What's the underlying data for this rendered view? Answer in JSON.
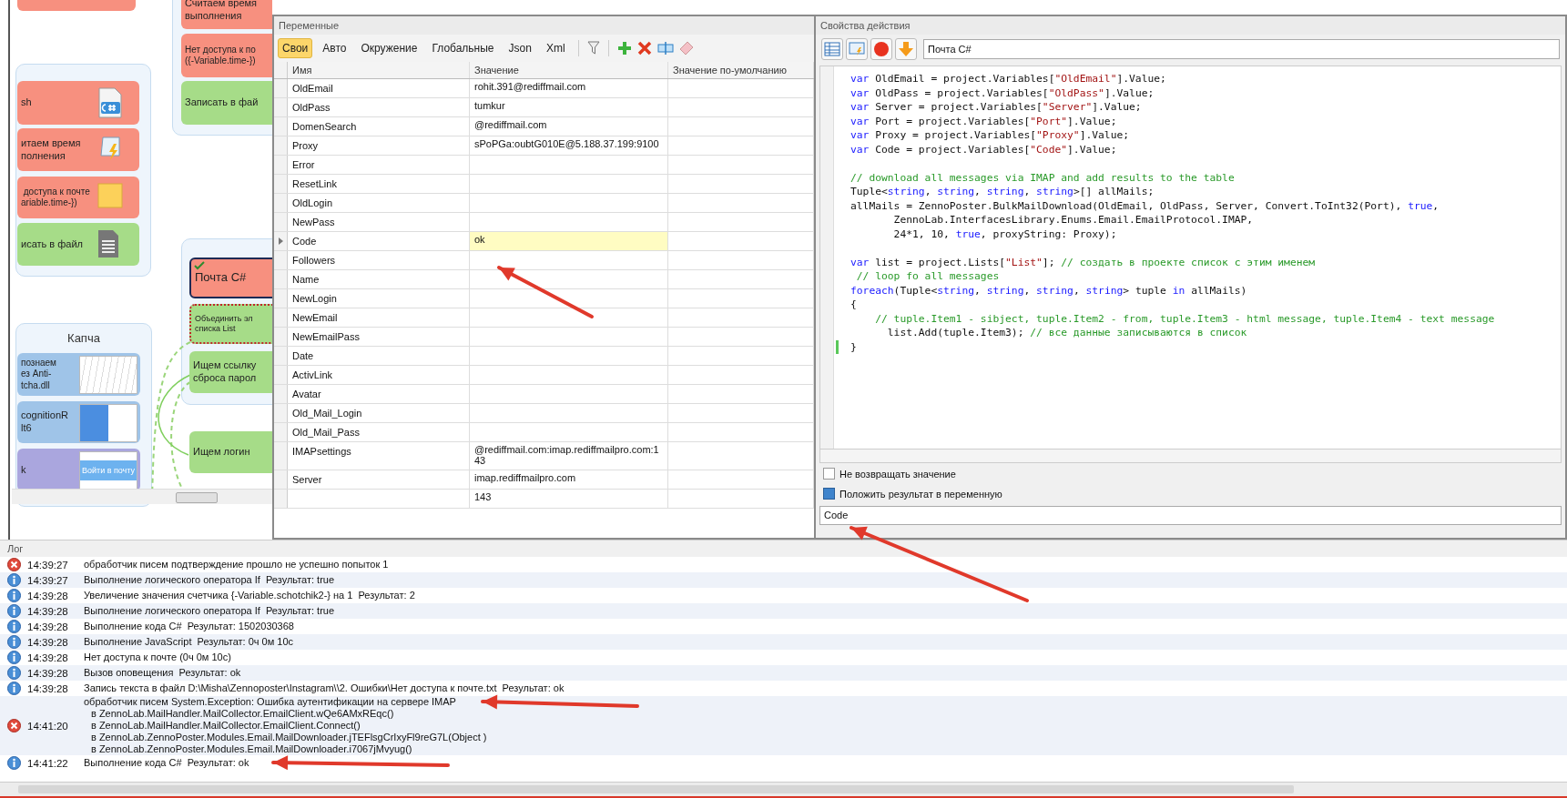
{
  "canvas": {
    "nodes": [
      {
        "lines": [
          "sh"
        ],
        "color": "#f7907f",
        "selected": false,
        "marked": false
      },
      {
        "lines": [
          "итаем время",
          "полнения"
        ],
        "color": "#f7907f",
        "selected": false,
        "marked": false
      },
      {
        "lines": [
          " доступа к почте",
          "ariable.time-})"
        ],
        "color": "#f7907f",
        "selected": false,
        "marked": false
      },
      {
        "lines": [
          "исать в файл"
        ],
        "color": "#a6dc88",
        "selected": false,
        "marked": false
      },
      {
        "lines": [
          "Считаем время",
          "выполнения"
        ],
        "color": "#f7907f",
        "selected": false,
        "marked": false
      },
      {
        "lines": [
          "Нет доступа к по",
          "({-Variable.time-})"
        ],
        "color": "#f7907f",
        "selected": false,
        "marked": false
      },
      {
        "lines": [
          "Записать в фай"
        ],
        "color": "#a6dc88",
        "selected": false,
        "marked": false
      },
      {
        "lines": [
          "Почта C#"
        ],
        "color": "#f7907f",
        "selected": true,
        "marked": false
      },
      {
        "lines": [
          "Объединить эл",
          "списка List"
        ],
        "color": "#a6dc88",
        "selected": false,
        "marked": true
      },
      {
        "lines": [
          "Ищем ссылку",
          "сброса парол"
        ],
        "color": "#a6dc88",
        "selected": false,
        "marked": false
      },
      {
        "lines": [
          "Ищем логин"
        ],
        "color": "#a6dc88",
        "selected": false,
        "marked": false
      },
      {
        "lines": [
          "познаем",
          "ез Anti-",
          "tcha.dll"
        ],
        "color": "#9fc4e8",
        "selected": false,
        "marked": false
      },
      {
        "lines": [
          "cognitionR",
          "lt6"
        ],
        "color": "#9fc4e8",
        "selected": false,
        "marked": false
      },
      {
        "lines": [
          "k"
        ],
        "color": "#aaa6de",
        "selected": false,
        "marked": false,
        "thumbnail": "Войти в почту"
      }
    ],
    "groups": [
      {
        "title": "Капча"
      }
    ]
  },
  "variables": {
    "title": "Переменные",
    "tabs": [
      {
        "label": "Свои",
        "selected": true
      },
      {
        "label": "Авто",
        "selected": false
      },
      {
        "label": "Окружение",
        "selected": false
      },
      {
        "label": "Глобальные",
        "selected": false
      },
      {
        "label": "Json",
        "selected": false
      },
      {
        "label": "Xml",
        "selected": false
      }
    ],
    "columns": [
      "Имя",
      "Значение",
      "Значение по-умолчанию"
    ],
    "rows": [
      {
        "name": "OldEmail",
        "value": "rohit.391@rediffmail.com",
        "selected": false
      },
      {
        "name": "OldPass",
        "value": "tumkur",
        "selected": false
      },
      {
        "name": "DomenSearch",
        "value": "@rediffmail.com",
        "selected": false
      },
      {
        "name": "Proxy",
        "value": "sPoPGa:oubtG010E@5.188.37.199:9100",
        "selected": false
      },
      {
        "name": "Error",
        "selected": false
      },
      {
        "name": "ResetLink",
        "selected": false
      },
      {
        "name": "OldLogin",
        "selected": false
      },
      {
        "name": "NewPass",
        "selected": false
      },
      {
        "name": "Code",
        "value": "ok",
        "selected": true
      },
      {
        "name": "Followers",
        "selected": false
      },
      {
        "name": "Name",
        "selected": false
      },
      {
        "name": "NewLogin",
        "selected": false
      },
      {
        "name": "NewEmail",
        "selected": false
      },
      {
        "name": "NewEmailPass",
        "selected": false
      },
      {
        "name": "Date",
        "selected": false
      },
      {
        "name": "ActivLink",
        "selected": false
      },
      {
        "name": "Avatar",
        "selected": false
      },
      {
        "name": "Old_Mail_Login",
        "selected": false
      },
      {
        "name": "Old_Mail_Pass",
        "selected": false
      },
      {
        "name": "IMAPsettings",
        "value": "@rediffmail.com:imap.rediffmailpro.com:143",
        "selected": false
      },
      {
        "name": "Server",
        "value": "imap.rediffmailpro.com",
        "selected": false
      },
      {
        "value": "143",
        "selected": false
      }
    ]
  },
  "properties": {
    "title": "Свойства действия",
    "action_name": "Почта C#",
    "code": [
      {
        "kind": "code",
        "modified": false,
        "segments": [
          {
            "kind": "keyword",
            "text": "var"
          },
          {
            "kind": "plain",
            "text": " OldEmail = project.Variables["
          },
          {
            "kind": "string",
            "text": "\"OldEmail\""
          },
          {
            "kind": "plain",
            "text": "].Value;"
          }
        ]
      },
      {
        "kind": "code",
        "modified": false,
        "segments": [
          {
            "kind": "keyword",
            "text": "var"
          },
          {
            "kind": "plain",
            "text": " OldPass = project.Variables["
          },
          {
            "kind": "string",
            "text": "\"OldPass\""
          },
          {
            "kind": "plain",
            "text": "].Value;"
          }
        ]
      },
      {
        "kind": "code",
        "modified": false,
        "segments": [
          {
            "kind": "keyword",
            "text": "var"
          },
          {
            "kind": "plain",
            "text": " Server = project.Variables["
          },
          {
            "kind": "string",
            "text": "\"Server\""
          },
          {
            "kind": "plain",
            "text": "].Value;"
          }
        ]
      },
      {
        "kind": "code",
        "modified": false,
        "segments": [
          {
            "kind": "keyword",
            "text": "var"
          },
          {
            "kind": "plain",
            "text": " Port = project.Variables["
          },
          {
            "kind": "string",
            "text": "\"Port\""
          },
          {
            "kind": "plain",
            "text": "].Value;"
          }
        ]
      },
      {
        "kind": "code",
        "modified": false,
        "segments": [
          {
            "kind": "keyword",
            "text": "var"
          },
          {
            "kind": "plain",
            "text": " Proxy = project.Variables["
          },
          {
            "kind": "string",
            "text": "\"Proxy\""
          },
          {
            "kind": "plain",
            "text": "].Value;"
          }
        ]
      },
      {
        "kind": "code",
        "modified": false,
        "segments": [
          {
            "kind": "keyword",
            "text": "var"
          },
          {
            "kind": "plain",
            "text": " Code = project.Variables["
          },
          {
            "kind": "string",
            "text": "\"Code\""
          },
          {
            "kind": "plain",
            "text": "].Value;"
          }
        ]
      },
      {
        "kind": "blank",
        "modified": false
      },
      {
        "kind": "code",
        "modified": false,
        "segments": [
          {
            "kind": "comment",
            "text": "// download all messages via IMAP and add results to the table"
          }
        ]
      },
      {
        "kind": "code",
        "modified": false,
        "segments": [
          {
            "kind": "plain",
            "text": "Tuple<"
          },
          {
            "kind": "keyword",
            "text": "string"
          },
          {
            "kind": "plain",
            "text": ", "
          },
          {
            "kind": "keyword",
            "text": "string"
          },
          {
            "kind": "plain",
            "text": ", "
          },
          {
            "kind": "keyword",
            "text": "string"
          },
          {
            "kind": "plain",
            "text": ", "
          },
          {
            "kind": "keyword",
            "text": "string"
          },
          {
            "kind": "plain",
            "text": ">[] allMails;"
          }
        ]
      },
      {
        "kind": "code",
        "modified": false,
        "segments": [
          {
            "kind": "plain",
            "text": "allMails = ZennoPoster.BulkMailDownload(OldEmail, OldPass, Server, Convert.ToInt32(Port), "
          },
          {
            "kind": "keyword",
            "text": "true"
          },
          {
            "kind": "plain",
            "text": ","
          }
        ]
      },
      {
        "kind": "code",
        "modified": false,
        "segments": [
          {
            "kind": "plain",
            "text": "       ZennoLab.InterfacesLibrary.Enums.Email.EmailProtocol.IMAP,"
          }
        ]
      },
      {
        "kind": "code",
        "modified": false,
        "segments": [
          {
            "kind": "plain",
            "text": "       24*1, 10, "
          },
          {
            "kind": "keyword",
            "text": "true"
          },
          {
            "kind": "plain",
            "text": ", proxyString: Proxy);"
          }
        ]
      },
      {
        "kind": "blank",
        "modified": false
      },
      {
        "kind": "code",
        "modified": false,
        "segments": [
          {
            "kind": "keyword",
            "text": "var"
          },
          {
            "kind": "plain",
            "text": " list = project.Lists["
          },
          {
            "kind": "string",
            "text": "\"List\""
          },
          {
            "kind": "plain",
            "text": "]; "
          },
          {
            "kind": "comment",
            "text": "// создать в проекте список с этим именем"
          }
        ]
      },
      {
        "kind": "code",
        "modified": false,
        "segments": [
          {
            "kind": "comment",
            "text": " // loop fo all messages"
          }
        ]
      },
      {
        "kind": "code",
        "modified": false,
        "segments": [
          {
            "kind": "keyword",
            "text": "foreach"
          },
          {
            "kind": "plain",
            "text": "(Tuple<"
          },
          {
            "kind": "keyword",
            "text": "string"
          },
          {
            "kind": "plain",
            "text": ", "
          },
          {
            "kind": "keyword",
            "text": "string"
          },
          {
            "kind": "plain",
            "text": ", "
          },
          {
            "kind": "keyword",
            "text": "string"
          },
          {
            "kind": "plain",
            "text": ", "
          },
          {
            "kind": "keyword",
            "text": "string"
          },
          {
            "kind": "plain",
            "text": "> tuple "
          },
          {
            "kind": "keyword",
            "text": "in"
          },
          {
            "kind": "plain",
            "text": " allMails)"
          }
        ]
      },
      {
        "kind": "code",
        "modified": false,
        "segments": [
          {
            "kind": "plain",
            "text": "{"
          }
        ]
      },
      {
        "kind": "code",
        "modified": false,
        "segments": [
          {
            "kind": "comment",
            "text": "    // tuple.Item1 - sibject, tuple.Item2 - from, tuple.Item3 - html message, tuple.Item4 - text message"
          }
        ]
      },
      {
        "kind": "code",
        "modified": false,
        "segments": [
          {
            "kind": "plain",
            "text": "      list.Add(tuple.Item3); "
          },
          {
            "kind": "comment",
            "text": "// все данные записываются в список"
          }
        ]
      },
      {
        "kind": "code",
        "modified": true,
        "segments": [
          {
            "kind": "plain",
            "text": "}"
          }
        ]
      }
    ],
    "options": [
      {
        "label": "Не возвращать значение",
        "checked": false
      },
      {
        "label": "Положить результат в переменную",
        "checked": true
      }
    ],
    "result_variable": "Code"
  },
  "log": {
    "title": "Лог",
    "entries": [
      {
        "kind": "error",
        "time": "14:39:27",
        "lines": [
          "обработчик писем подтверждение прошло не успешно попыток 1"
        ]
      },
      {
        "kind": "info",
        "time": "14:39:27",
        "lines": [
          "Выполнение логического оператора If  Результат: true"
        ]
      },
      {
        "kind": "info",
        "time": "14:39:28",
        "lines": [
          "Увеличение значения счетчика {-Variable.schotchik2-} на 1  Результат: 2"
        ]
      },
      {
        "kind": "info",
        "time": "14:39:28",
        "lines": [
          "Выполнение логического оператора If  Результат: true"
        ]
      },
      {
        "kind": "info",
        "time": "14:39:28",
        "lines": [
          "Выполнение кода C#  Результат: 1502030368"
        ]
      },
      {
        "kind": "info",
        "time": "14:39:28",
        "lines": [
          "Выполнение JavaScript  Результат: 0ч 0м 10с"
        ]
      },
      {
        "kind": "info",
        "time": "14:39:28",
        "lines": [
          "Нет доступа к почте (0ч 0м 10с)"
        ]
      },
      {
        "kind": "info",
        "time": "14:39:28",
        "lines": [
          "Вызов оповещения  Результат: ok"
        ]
      },
      {
        "kind": "info",
        "time": "14:39:28",
        "lines": [
          "Запись текста в файл D:\\Misha\\Zennoposter\\Instagram\\\\2. Ошибки\\Нет доступа к почте.txt  Результат: ok"
        ]
      },
      {
        "kind": "error",
        "time": "14:41:20",
        "lines": [
          "обработчик писем System.Exception: Ошибка аутентификации на сервере IMAP",
          "в ZennoLab.MailHandler.MailCollector.EmailClient.wQe6AMxREqc()",
          "в ZennoLab.MailHandler.MailCollector.EmailClient.Connect()",
          "в ZennoLab.ZennoPoster.Modules.Email.MailDownloader.jTEFlsgCrIxyFl9reG7L(Object )",
          "в ZennoLab.ZennoPoster.Modules.Email.MailDownloader.i7067jMvyug()"
        ]
      },
      {
        "kind": "info",
        "time": "14:41:22",
        "lines": [
          "Выполнение кода C#  Результат: ok"
        ]
      }
    ]
  }
}
